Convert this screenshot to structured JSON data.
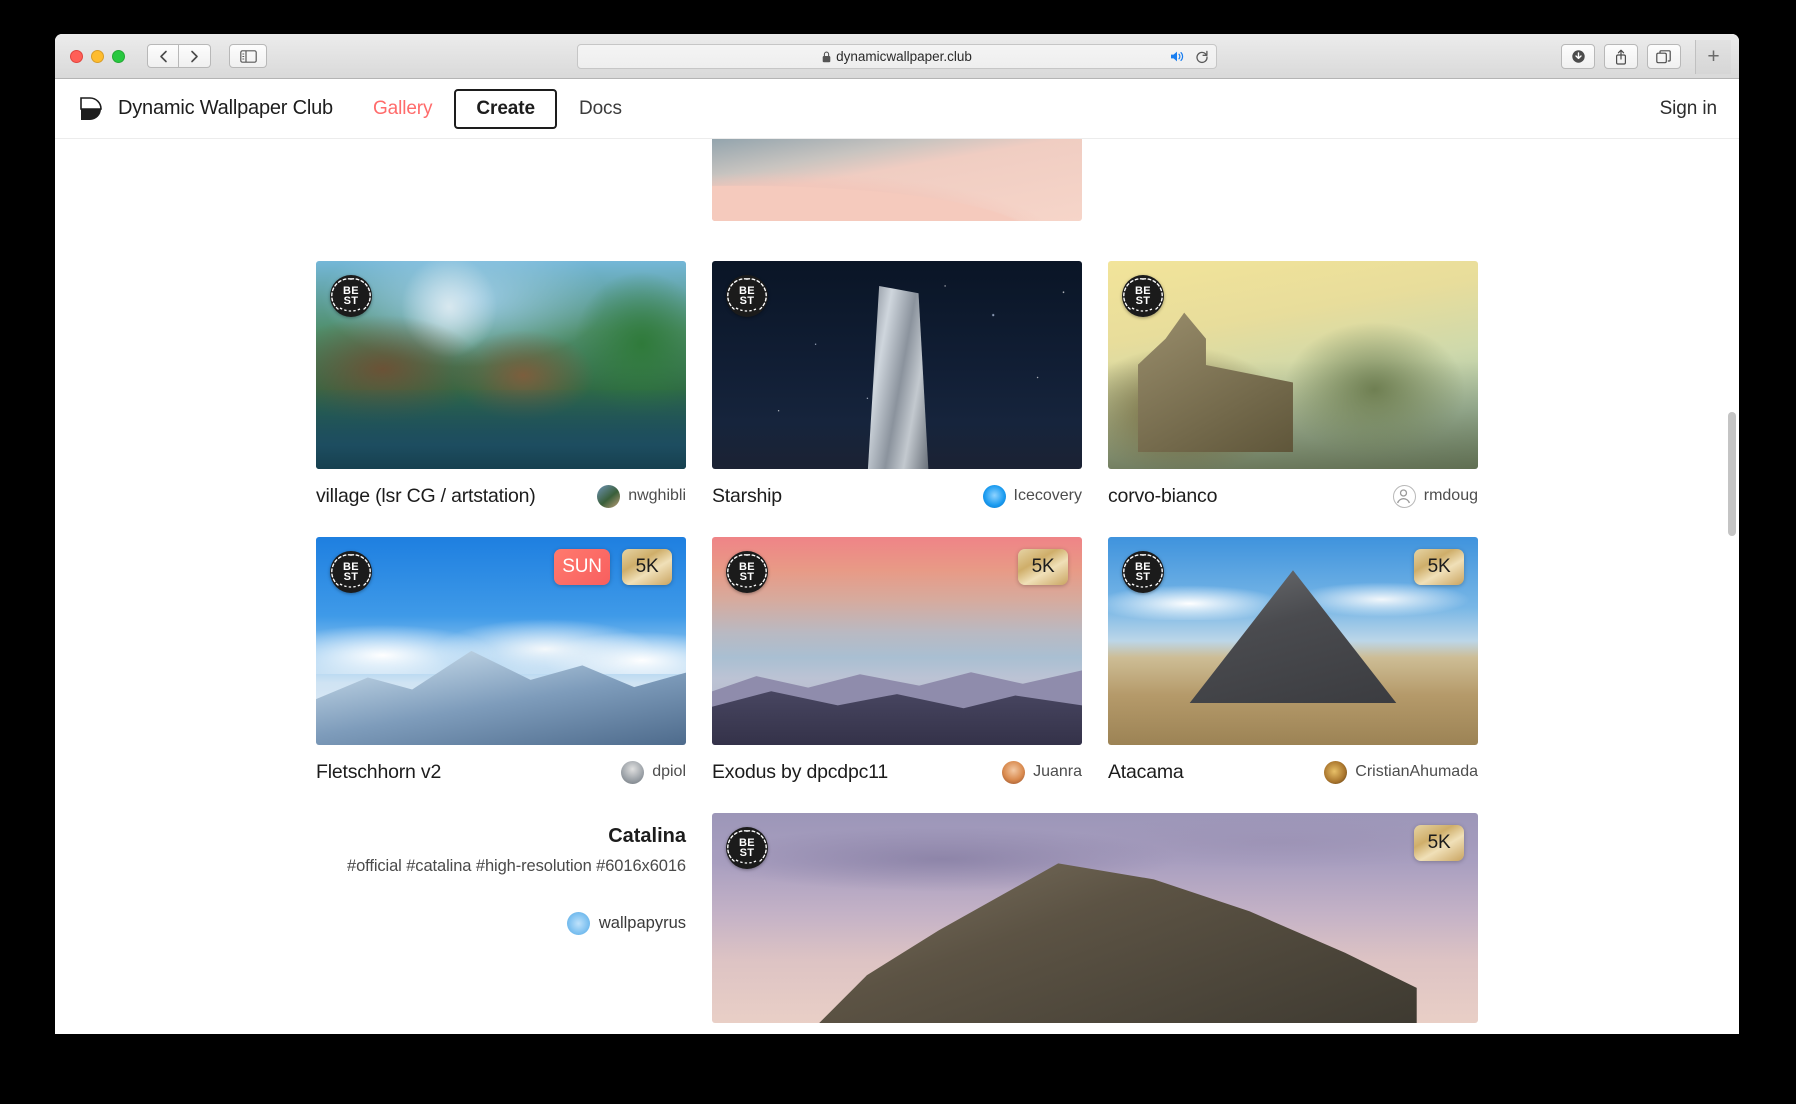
{
  "browser": {
    "url": "dynamicwallpaper.club",
    "lock_icon": "lock-icon",
    "audio_icon": "speaker-playing-icon",
    "reload_icon": "reload-icon",
    "back_icon": "chevron-left-icon",
    "forward_icon": "chevron-right-icon",
    "sidebar_icon": "sidebar-toggle-icon",
    "download_icon": "download-icon",
    "share_icon": "share-icon",
    "tabs_icon": "show-tabs-icon",
    "newtab_label": "+"
  },
  "header": {
    "logo_icon": "dynamic-wallpaper-logo-icon",
    "brand": "Dynamic Wallpaper Club",
    "nav": [
      {
        "label": "Gallery",
        "style": "active"
      },
      {
        "label": "Create",
        "style": "boxed"
      },
      {
        "label": "Docs",
        "style": "plain"
      }
    ],
    "signin": "Sign in",
    "accent_color": "#ff6b6b"
  },
  "gallery": {
    "partial_top": {
      "art": "art-dune"
    },
    "rows": [
      {
        "cards": [
          {
            "art": "art-village",
            "title": "village (lsr CG / artstation)",
            "author": "nwghibli",
            "avatar_color": "#4a6b8a",
            "badges": {
              "best": "BEST",
              "sun": null,
              "res": null
            }
          },
          {
            "art": "art-starship",
            "title": "Starship",
            "author": "Icecovery",
            "avatar_color": "#1a9bf0",
            "badges": {
              "best": "BEST",
              "sun": null,
              "res": null
            }
          },
          {
            "art": "art-corvo",
            "title": "corvo-bianco",
            "author": "rmdoug",
            "avatar_color": "#ffffff",
            "badges": {
              "best": "BEST",
              "sun": null,
              "res": null
            }
          }
        ]
      },
      {
        "cards": [
          {
            "art": "art-fletsch",
            "title": "Fletschhorn v2",
            "author": "dpiol",
            "avatar_color": "#9aa0a6",
            "badges": {
              "best": "BEST",
              "sun": "SUN",
              "res": "5K"
            }
          },
          {
            "art": "art-exodus",
            "title": "Exodus by dpcdpc11",
            "author": "Juanra",
            "avatar_color": "#e28b5a",
            "badges": {
              "best": "BEST",
              "sun": null,
              "res": "5K"
            }
          },
          {
            "art": "art-atacama",
            "title": "Atacama",
            "author": "CristianAhumada",
            "avatar_color": "#c08a3a",
            "badges": {
              "best": "BEST",
              "sun": null,
              "res": "5K"
            }
          }
        ]
      }
    ],
    "feature": {
      "title": "Catalina",
      "tags": "#official #catalina #high-resolution #6016x6016",
      "author": "wallpapyrus",
      "avatar_color": "#7cc0f0",
      "art": "art-catalina",
      "badges": {
        "best": "BEST",
        "res": "5K"
      }
    }
  }
}
